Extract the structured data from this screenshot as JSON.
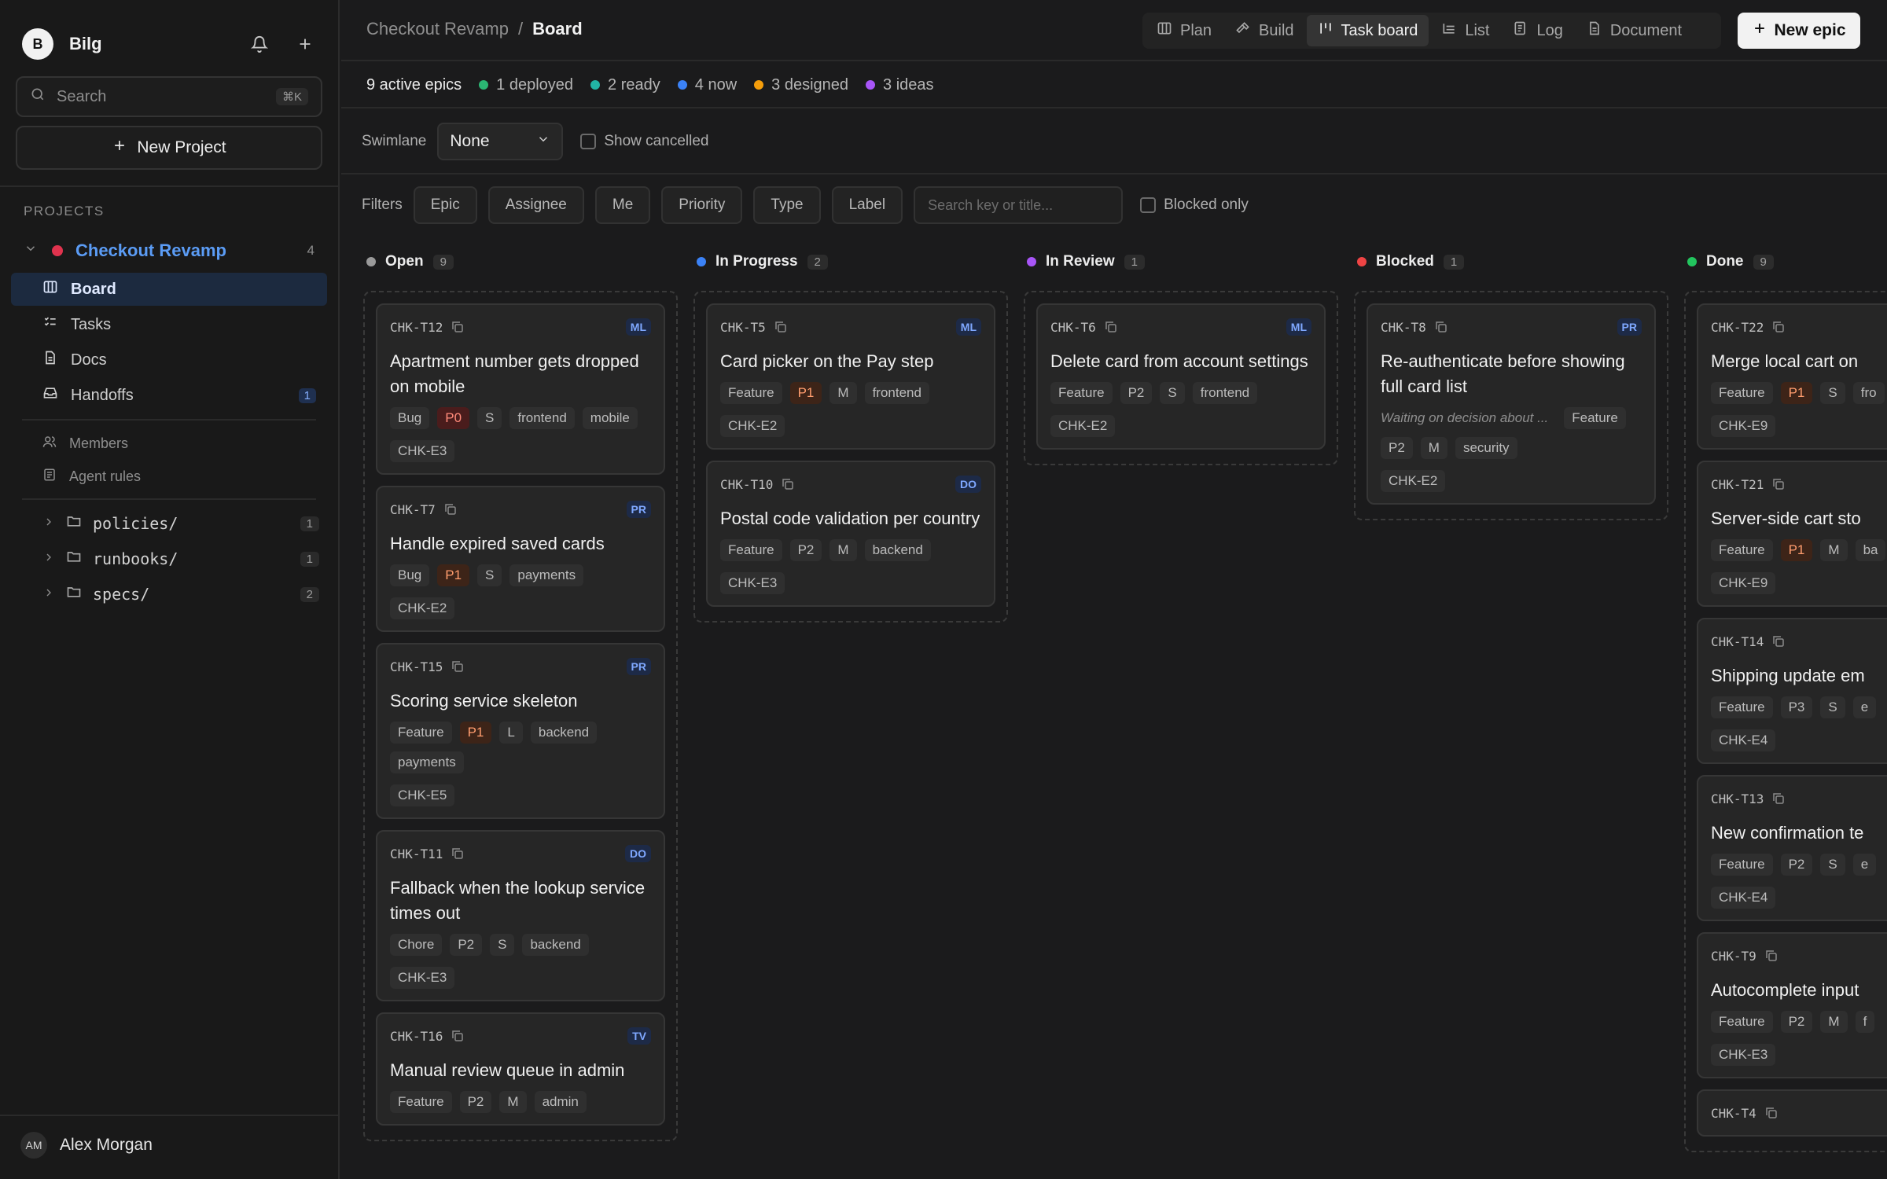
{
  "workspace": {
    "logo_letter": "B",
    "name": "Bilg"
  },
  "search": {
    "placeholder": "Search",
    "shortcut": "⌘K"
  },
  "new_project_label": "New Project",
  "projects_label": "PROJECTS",
  "project": {
    "name": "Checkout Revamp",
    "count": "4",
    "color": "#e0334e"
  },
  "nav": [
    {
      "label": "Board",
      "icon": "board-icon"
    },
    {
      "label": "Tasks",
      "icon": "tasks-icon"
    },
    {
      "label": "Docs",
      "icon": "docs-icon"
    },
    {
      "label": "Handoffs",
      "icon": "inbox-icon",
      "badge": "1"
    }
  ],
  "secondary_nav": [
    {
      "label": "Members",
      "icon": "members-icon"
    },
    {
      "label": "Agent rules",
      "icon": "rules-icon"
    }
  ],
  "folders": [
    {
      "name": "policies/",
      "count": "1"
    },
    {
      "name": "runbooks/",
      "count": "1"
    },
    {
      "name": "specs/",
      "count": "2"
    }
  ],
  "user": {
    "initials": "AM",
    "name": "Alex Morgan"
  },
  "breadcrumb": {
    "parent": "Checkout Revamp",
    "separator": "/",
    "current": "Board"
  },
  "view_tabs": [
    {
      "label": "Plan",
      "icon": "plan-icon"
    },
    {
      "label": "Build",
      "icon": "hammer-icon"
    },
    {
      "label": "Task board",
      "icon": "taskboard-icon",
      "active": true
    },
    {
      "label": "List",
      "icon": "list-icon"
    },
    {
      "label": "Log",
      "icon": "log-icon"
    },
    {
      "label": "Document",
      "icon": "document-icon"
    }
  ],
  "new_epic_label": "New epic",
  "stats": {
    "total": "9 active epics",
    "items": [
      {
        "label": "1 deployed",
        "color": "#2bb673"
      },
      {
        "label": "2 ready",
        "color": "#22b5a5"
      },
      {
        "label": "4 now",
        "color": "#3b82f6"
      },
      {
        "label": "3 designed",
        "color": "#f59e0b"
      },
      {
        "label": "3 ideas",
        "color": "#a855f7"
      }
    ]
  },
  "toolbar": {
    "swimlane_label": "Swimlane",
    "swimlane_value": "None",
    "show_cancelled": "Show cancelled",
    "filters_label": "Filters",
    "filters": [
      "Epic",
      "Assignee",
      "Me",
      "Priority",
      "Type",
      "Label"
    ],
    "search_placeholder": "Search key or title...",
    "blocked_only": "Blocked only"
  },
  "columns": [
    {
      "name": "Open",
      "count": "9",
      "color": "#9a9a9a",
      "cards": [
        {
          "key": "CHK-T12",
          "assignee": "ML",
          "title": "Apartment number gets dropped on mobile",
          "tags": [
            "Bug",
            "P0",
            "S",
            "frontend",
            "mobile"
          ],
          "epic": "CHK-E3"
        },
        {
          "key": "CHK-T7",
          "assignee": "PR",
          "title": "Handle expired saved cards",
          "tags": [
            "Bug",
            "P1",
            "S",
            "payments"
          ],
          "epic": "CHK-E2"
        },
        {
          "key": "CHK-T15",
          "assignee": "PR",
          "title": "Scoring service skeleton",
          "tags": [
            "Feature",
            "P1",
            "L",
            "backend",
            "payments"
          ],
          "epic": "CHK-E5"
        },
        {
          "key": "CHK-T11",
          "assignee": "DO",
          "title": "Fallback when the lookup service times out",
          "tags": [
            "Chore",
            "P2",
            "S",
            "backend"
          ],
          "epic": "CHK-E3"
        },
        {
          "key": "CHK-T16",
          "assignee": "TV",
          "title": "Manual review queue in admin",
          "tags": [
            "Feature",
            "P2",
            "M",
            "admin"
          ],
          "epic": ""
        }
      ]
    },
    {
      "name": "In Progress",
      "count": "2",
      "color": "#3b82f6",
      "cards": [
        {
          "key": "CHK-T5",
          "assignee": "ML",
          "title": "Card picker on the Pay step",
          "tags": [
            "Feature",
            "P1",
            "M",
            "frontend"
          ],
          "epic": "CHK-E2"
        },
        {
          "key": "CHK-T10",
          "assignee": "DO",
          "title": "Postal code validation per country",
          "tags": [
            "Feature",
            "P2",
            "M",
            "backend"
          ],
          "epic": "CHK-E3"
        }
      ]
    },
    {
      "name": "In Review",
      "count": "1",
      "color": "#a855f7",
      "cards": [
        {
          "key": "CHK-T6",
          "assignee": "ML",
          "title": "Delete card from account settings",
          "tags": [
            "Feature",
            "P2",
            "S",
            "frontend"
          ],
          "epic": "CHK-E2"
        }
      ]
    },
    {
      "name": "Blocked",
      "count": "1",
      "color": "#ef4444",
      "cards": [
        {
          "key": "CHK-T8",
          "assignee": "PR",
          "title": "Re-authenticate before showing full card list",
          "note": "Waiting on decision about ...",
          "tags": [
            "Feature",
            "P2",
            "M",
            "security"
          ],
          "epic": "CHK-E2"
        }
      ]
    },
    {
      "name": "Done",
      "count": "9",
      "color": "#22c55e",
      "cards": [
        {
          "key": "CHK-T22",
          "assignee": "",
          "title": "Merge local cart on",
          "tags": [
            "Feature",
            "P1",
            "S",
            "fro"
          ],
          "epic": "CHK-E9"
        },
        {
          "key": "CHK-T21",
          "assignee": "",
          "title": "Server-side cart sto",
          "tags": [
            "Feature",
            "P1",
            "M",
            "ba"
          ],
          "epic": "CHK-E9"
        },
        {
          "key": "CHK-T14",
          "assignee": "",
          "title": "Shipping update em",
          "tags": [
            "Feature",
            "P3",
            "S",
            "e"
          ],
          "epic": "CHK-E4"
        },
        {
          "key": "CHK-T13",
          "assignee": "",
          "title": "New confirmation te",
          "tags": [
            "Feature",
            "P2",
            "S",
            "e"
          ],
          "epic": "CHK-E4"
        },
        {
          "key": "CHK-T9",
          "assignee": "",
          "title": "Autocomplete input",
          "tags": [
            "Feature",
            "P2",
            "M",
            "f"
          ],
          "epic": "CHK-E3"
        },
        {
          "key": "CHK-T4",
          "assignee": "",
          "title": "",
          "tags": [],
          "epic": ""
        }
      ]
    }
  ]
}
